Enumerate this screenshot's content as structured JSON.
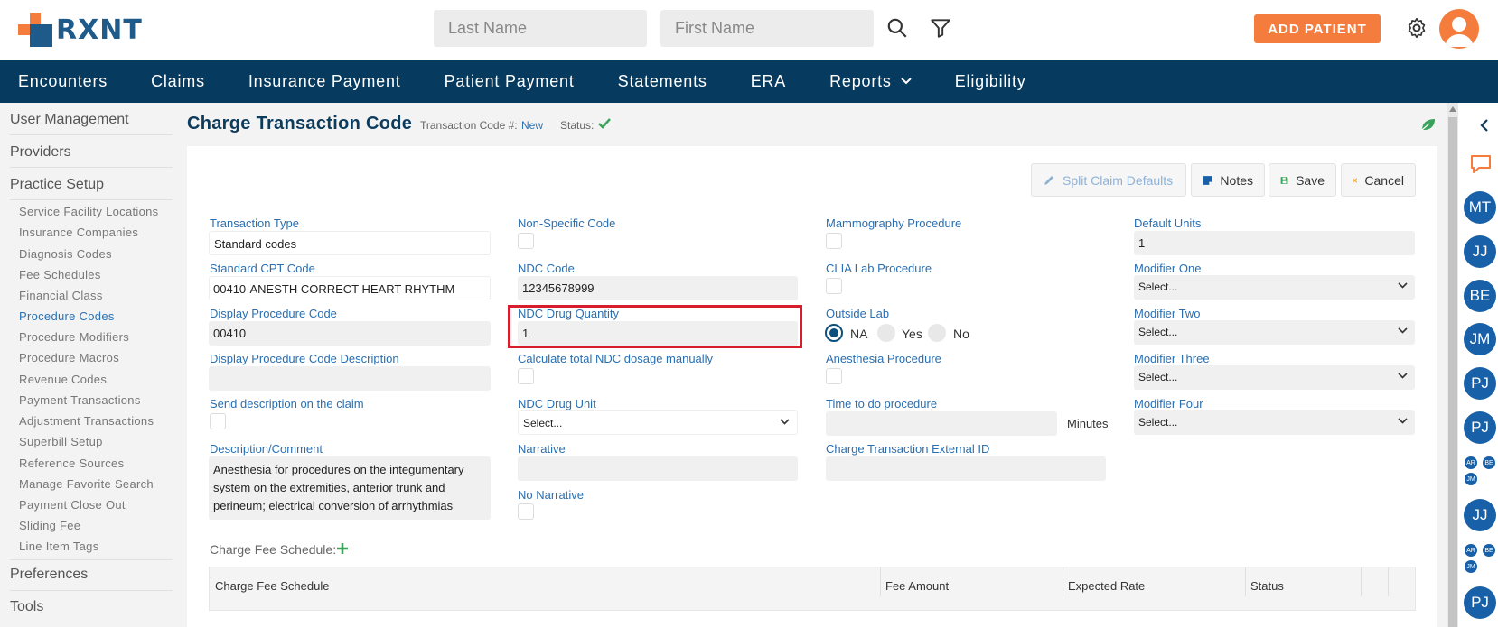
{
  "header": {
    "logo_text": "RXNT",
    "last_name_placeholder": "Last Name",
    "first_name_placeholder": "First Name",
    "add_patient_label": "ADD PATIENT"
  },
  "nav": {
    "items": [
      "Encounters",
      "Claims",
      "Insurance Payment",
      "Patient Payment",
      "Statements",
      "ERA",
      "Reports",
      "Eligibility"
    ]
  },
  "sidebar": {
    "sections": [
      "User Management",
      "Providers",
      "Practice Setup",
      "Preferences",
      "Tools"
    ],
    "practice_setup_items": [
      "Service Facility Locations",
      "Insurance Companies",
      "Diagnosis Codes",
      "Fee Schedules",
      "Financial Class",
      "Procedure Codes",
      "Procedure Modifiers",
      "Procedure Macros",
      "Revenue Codes",
      "Payment Transactions",
      "Adjustment Transactions",
      "Superbill Setup",
      "Reference Sources",
      "Manage Favorite Search",
      "Payment Close Out",
      "Sliding Fee",
      "Line Item Tags"
    ],
    "active_item": "Procedure Codes"
  },
  "page": {
    "title": "Charge Transaction Code",
    "transaction_code_label": "Transaction Code #:",
    "transaction_code_value": "New",
    "status_label": "Status:"
  },
  "toolbar": {
    "split_claim_label": "Split Claim Defaults",
    "notes_label": "Notes",
    "save_label": "Save",
    "cancel_label": "Cancel"
  },
  "form": {
    "transaction_type_label": "Transaction Type",
    "transaction_type_value": "Standard codes",
    "standard_cpt_label": "Standard CPT Code",
    "standard_cpt_value": "00410-ANESTH CORRECT HEART RHYTHM",
    "display_code_label": "Display Procedure Code",
    "display_code_value": "00410",
    "display_desc_label": "Display Procedure Code Description",
    "send_desc_label": "Send description on the claim",
    "desc_comment_label": "Description/Comment",
    "desc_comment_line1": "Anesthesia for procedures on the integumentary",
    "desc_comment_line2": "system on the extremities, anterior trunk and",
    "desc_comment_line3": "perineum; electrical conversion of arrhythmias",
    "non_specific_label": "Non-Specific Code",
    "ndc_code_label": "NDC Code",
    "ndc_code_value": "12345678999",
    "ndc_qty_label": "NDC Drug Quantity",
    "ndc_qty_value": "1",
    "calc_ndc_label": "Calculate total NDC dosage manually",
    "ndc_unit_label": "NDC Drug Unit",
    "ndc_unit_value": "Select...",
    "narrative_label": "Narrative",
    "no_narrative_label": "No Narrative",
    "mammography_label": "Mammography Procedure",
    "clia_label": "CLIA Lab Procedure",
    "outside_lab_label": "Outside Lab",
    "outside_lab_options": [
      "NA",
      "Yes",
      "No"
    ],
    "anesthesia_label": "Anesthesia Procedure",
    "time_label": "Time to do procedure",
    "minutes_label": "Minutes",
    "external_id_label": "Charge Transaction External ID",
    "default_units_label": "Default Units",
    "default_units_value": "1",
    "modifier_one_label": "Modifier One",
    "modifier_two_label": "Modifier Two",
    "modifier_three_label": "Modifier Three",
    "modifier_four_label": "Modifier Four",
    "modifier_placeholder": "Select..."
  },
  "fee_schedule": {
    "label": "Charge Fee Schedule:",
    "columns": [
      "Charge Fee Schedule",
      "Fee Amount",
      "Expected Rate",
      "Status"
    ]
  },
  "right_panel": {
    "avatars": [
      "MT",
      "JJ",
      "BE",
      "JM",
      "PJ",
      "PJ",
      "JJ",
      "PJ"
    ],
    "mini_group_1": [
      "AR",
      "BE",
      "JM"
    ],
    "mini_group_2": [
      "AR",
      "BE",
      "JM"
    ]
  },
  "colors": {
    "brand_orange": "#f47c3c",
    "brand_blue": "#1e5b8a",
    "nav_bg": "#063a5e",
    "label_blue": "#2a6fb0",
    "highlight_red": "#d81e2c"
  }
}
